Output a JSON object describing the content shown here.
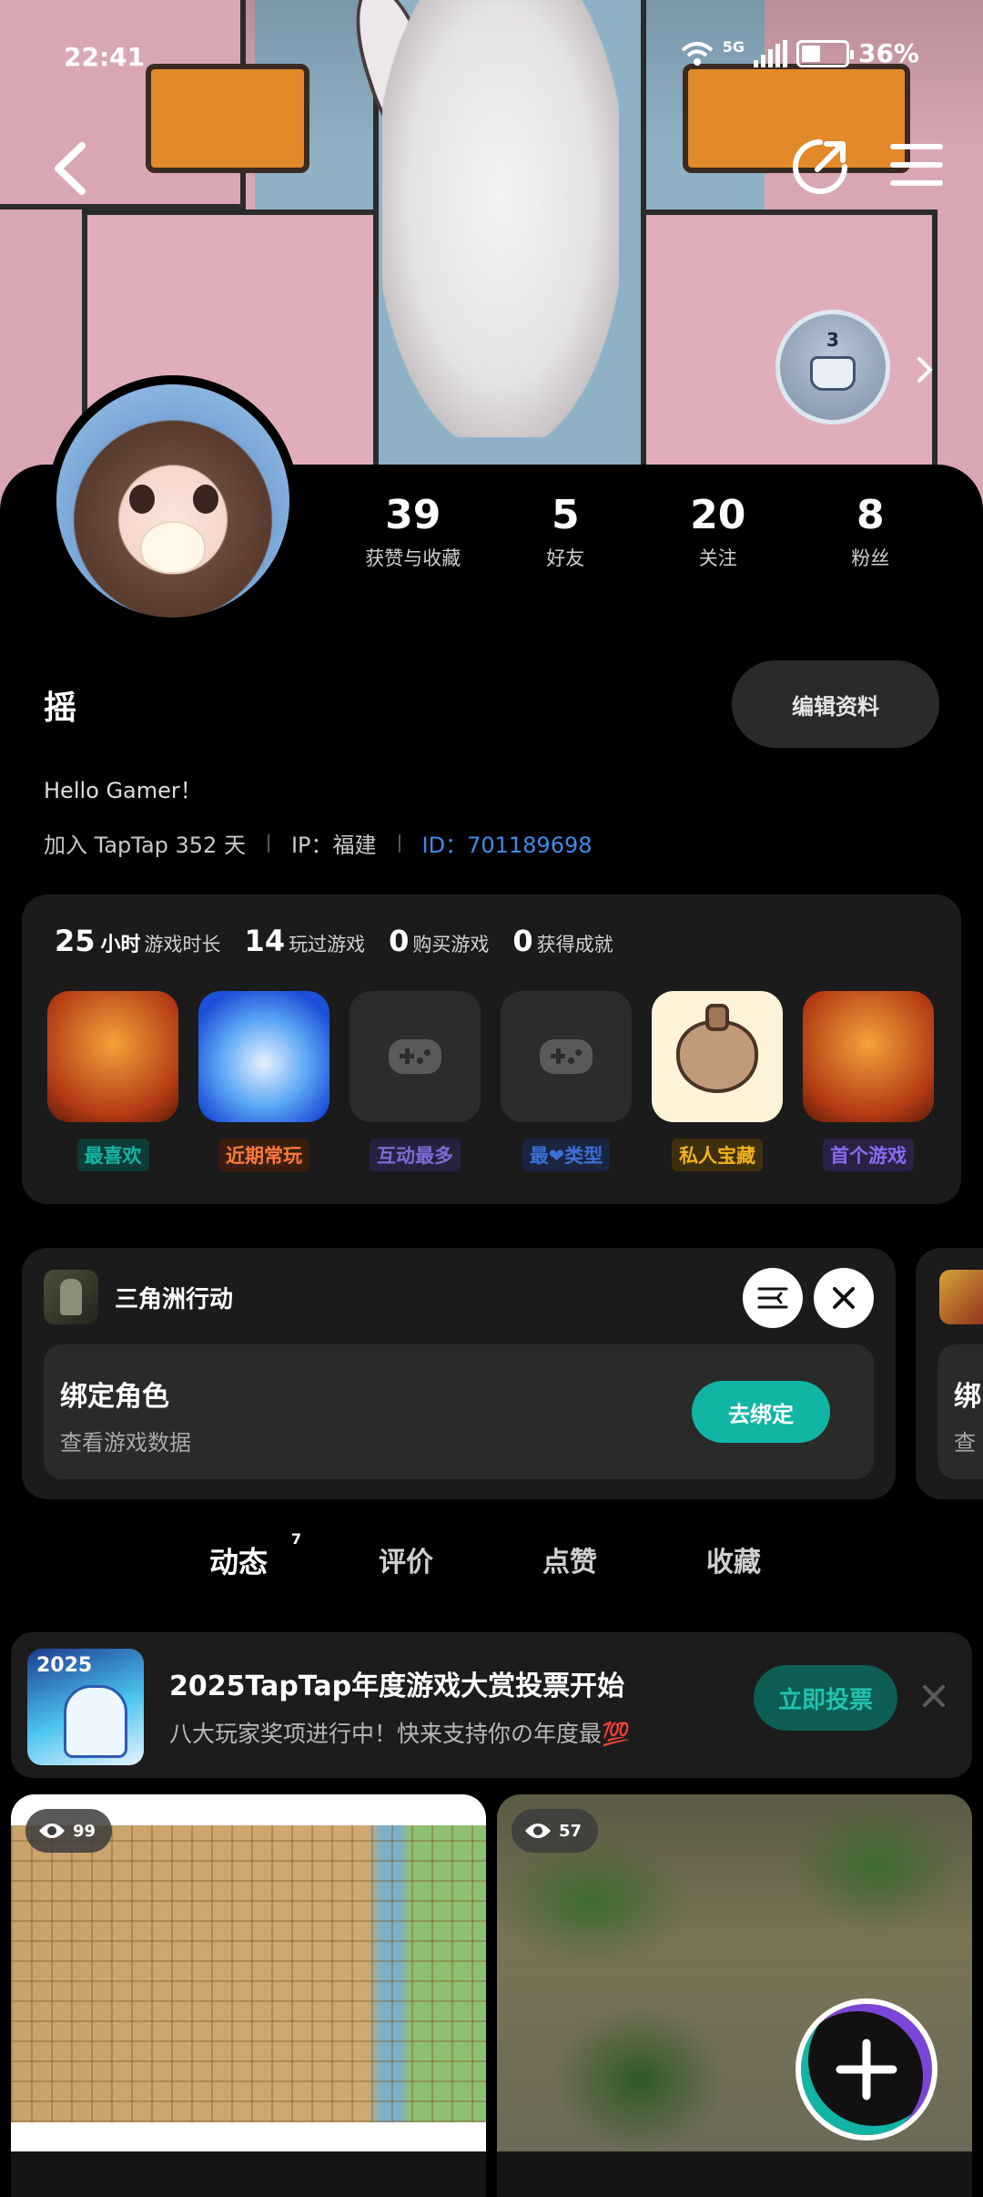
{
  "status": {
    "time": "22:41",
    "network": "5G",
    "battery": "36%"
  },
  "level": {
    "number": "3"
  },
  "stats": [
    {
      "value": "39",
      "label": "获赞与收藏"
    },
    {
      "value": "5",
      "label": "好友"
    },
    {
      "value": "20",
      "label": "关注"
    },
    {
      "value": "8",
      "label": "粉丝"
    }
  ],
  "profile": {
    "username": "摇",
    "edit_label": "编辑资料",
    "bio": "Hello Gamer！",
    "joined": "加入 TapTap 352 天",
    "ip": "IP：福建",
    "id": "ID：701189698"
  },
  "game_stats": [
    {
      "num": "25",
      "unit": "小时",
      "text": "游戏时长"
    },
    {
      "num": "14",
      "unit": "",
      "text": "玩过游戏"
    },
    {
      "num": "0",
      "unit": "",
      "text": "购买游戏"
    },
    {
      "num": "0",
      "unit": "",
      "text": "获得成就"
    }
  ],
  "tiles": [
    {
      "label": "最喜欢",
      "label_color": "#13b5a4",
      "label_bg": "#0e3b36"
    },
    {
      "label": "近期常玩",
      "label_color": "#ff7b3b",
      "label_bg": "#3b1e12"
    },
    {
      "label": "互动最多",
      "label_color": "#7c6bd6",
      "label_bg": "#26213e"
    },
    {
      "label": "最❤类型",
      "label_color": "#3d6fd6",
      "label_bg": "#1a2540"
    },
    {
      "label": "私人宝藏",
      "label_color": "#f0b11d",
      "label_bg": "#3e2f0e"
    },
    {
      "label": "首个游戏",
      "label_color": "#8a6bf0",
      "label_bg": "#2a2145"
    }
  ],
  "bind": {
    "game": "三角洲行动",
    "role": "绑定角色",
    "sub": "查看游戏数据",
    "button": "去绑定",
    "next_role": "绑",
    "next_sub": "查"
  },
  "tabs": [
    {
      "label": "动态",
      "badge": "7"
    },
    {
      "label": "评价"
    },
    {
      "label": "点赞"
    },
    {
      "label": "收藏"
    }
  ],
  "banner": {
    "year": "2025",
    "title": "2025TapTap年度游戏大赏投票开始",
    "sub": "八大玩家奖项进行中！快来支持你の年度最💯",
    "button": "立即投票"
  },
  "feed": [
    {
      "views": "99"
    },
    {
      "views": "57"
    }
  ]
}
